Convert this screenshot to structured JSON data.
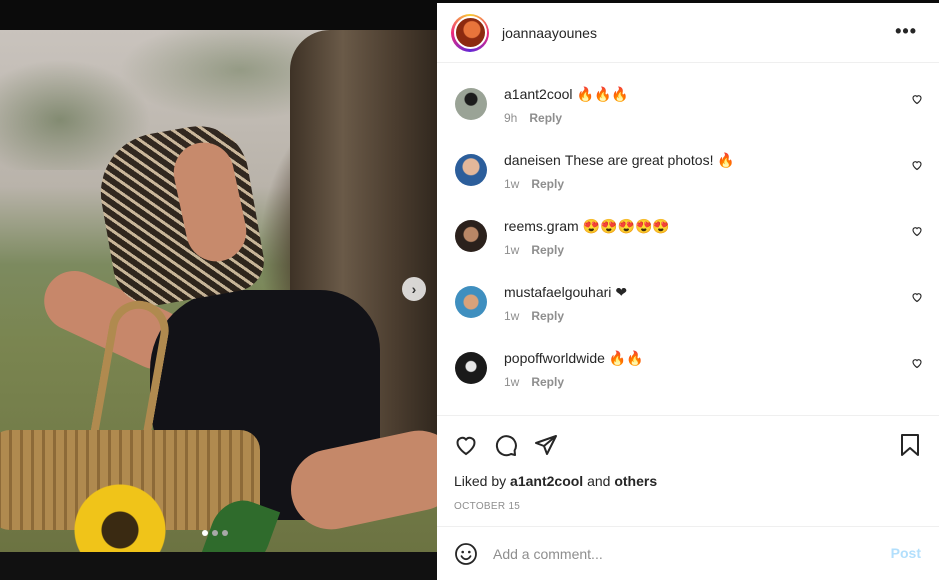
{
  "post": {
    "author": "joannaayounes",
    "more_label": "•••",
    "carousel": {
      "current_index": 1,
      "total": 3,
      "next_label": "›"
    }
  },
  "comments": [
    {
      "user": "a1ant2cool",
      "text": "🔥🔥🔥",
      "time": "9h",
      "reply": "Reply",
      "avatar_color": "#4a4f46"
    },
    {
      "user": "daneisen",
      "text": "These are great photos! 🔥",
      "time": "1w",
      "reply": "Reply",
      "avatar_color": "#3b6fa8"
    },
    {
      "user": "reems.gram",
      "text": "😍😍😍😍😍",
      "time": "1w",
      "reply": "Reply",
      "avatar_color": "#5a3a2c"
    },
    {
      "user": "mustafaelgouhari",
      "text": "❤",
      "time": "1w",
      "reply": "Reply",
      "avatar_color": "#5ab0d8"
    },
    {
      "user": "popoffworldwide",
      "text": "🔥🔥",
      "time": "1w",
      "reply": "Reply",
      "avatar_color": "#2a2a2a"
    }
  ],
  "likes": {
    "prefix": "Liked by",
    "user": "a1ant2cool",
    "and": "and",
    "others": "others"
  },
  "date": "OCTOBER 15",
  "composer": {
    "placeholder": "Add a comment...",
    "post_label": "Post"
  },
  "colors": {
    "accent_disabled": "#b2dffc",
    "muted_text": "#8e8e8e",
    "primary_text": "#262626"
  },
  "icons": [
    "heart-icon",
    "comment-icon",
    "share-icon",
    "bookmark-icon",
    "emoji-icon",
    "more-icon",
    "chevron-right-icon"
  ]
}
